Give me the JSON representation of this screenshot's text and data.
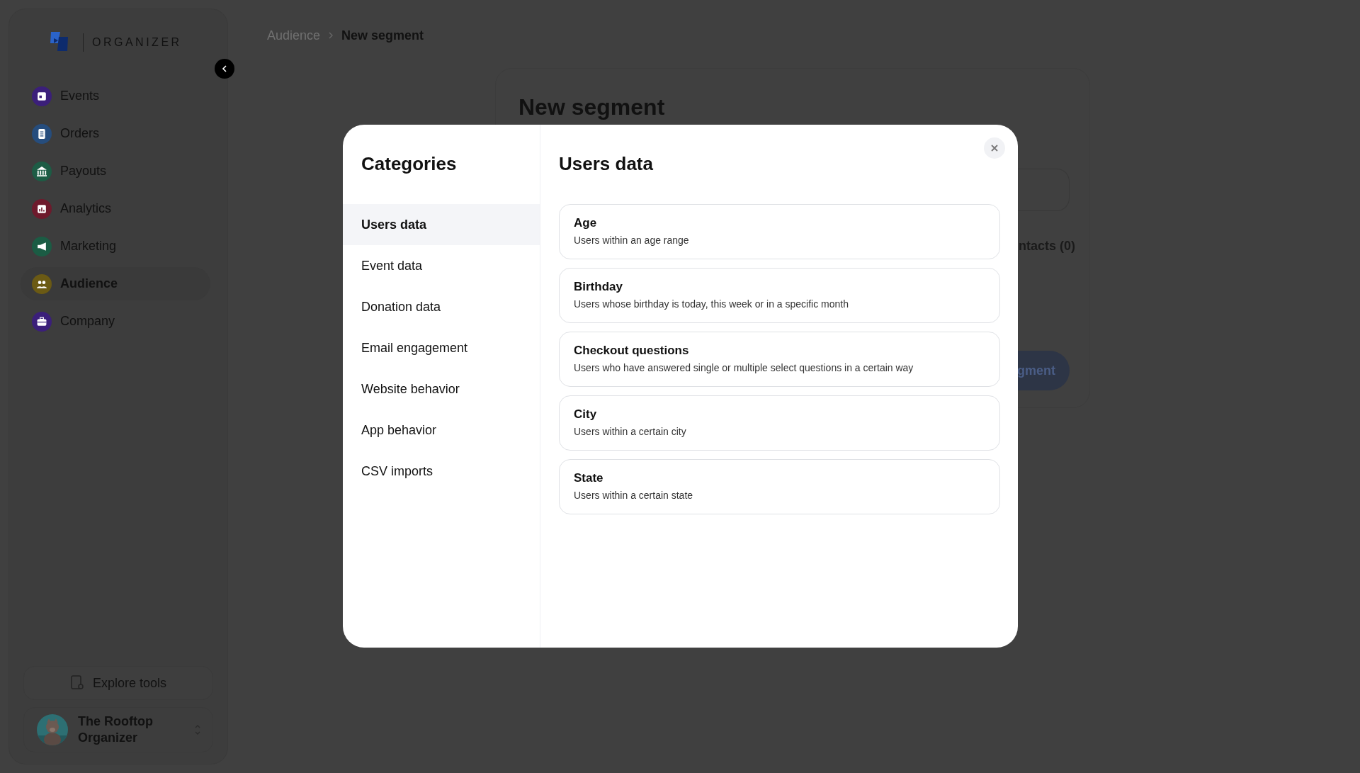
{
  "sidebar": {
    "brand": "ORGANIZER",
    "nav": [
      {
        "label": "Events",
        "color": "#3b1f7a",
        "selected": false
      },
      {
        "label": "Orders",
        "color": "#264d7d",
        "selected": false
      },
      {
        "label": "Payouts",
        "color": "#1d5c45",
        "selected": false
      },
      {
        "label": "Analytics",
        "color": "#6e1a2c",
        "selected": false
      },
      {
        "label": "Marketing",
        "color": "#1b5c44",
        "selected": false
      },
      {
        "label": "Audience",
        "color": "#6b5a14",
        "selected": true
      },
      {
        "label": "Company",
        "color": "#3b1f7a",
        "selected": false
      }
    ],
    "explore_button": "Explore tools",
    "account": {
      "name": "The Rooftop Organizer"
    }
  },
  "breadcrumb": [
    {
      "label": "Audience",
      "current": false
    },
    {
      "label": "New segment",
      "current": true
    }
  ],
  "page": {
    "title": "New segment",
    "contacts_label": "ntacts (0)",
    "save_button": "gment"
  },
  "modal": {
    "categories_title": "Categories",
    "categories": [
      {
        "label": "Users data",
        "selected": true
      },
      {
        "label": "Event data",
        "selected": false
      },
      {
        "label": "Donation data",
        "selected": false
      },
      {
        "label": "Email engagement",
        "selected": false
      },
      {
        "label": "Website behavior",
        "selected": false
      },
      {
        "label": "App behavior",
        "selected": false
      },
      {
        "label": "CSV imports",
        "selected": false
      }
    ],
    "section_title": "Users data",
    "options": [
      {
        "title": "Age",
        "description": "Users within an age range"
      },
      {
        "title": "Birthday",
        "description": "Users whose birthday is today, this week or in a specific month"
      },
      {
        "title": "Checkout questions",
        "description": "Users who have answered single or multiple select questions in a certain way"
      },
      {
        "title": "City",
        "description": "Users within a certain city"
      },
      {
        "title": "State",
        "description": "Users within a certain state"
      }
    ]
  }
}
